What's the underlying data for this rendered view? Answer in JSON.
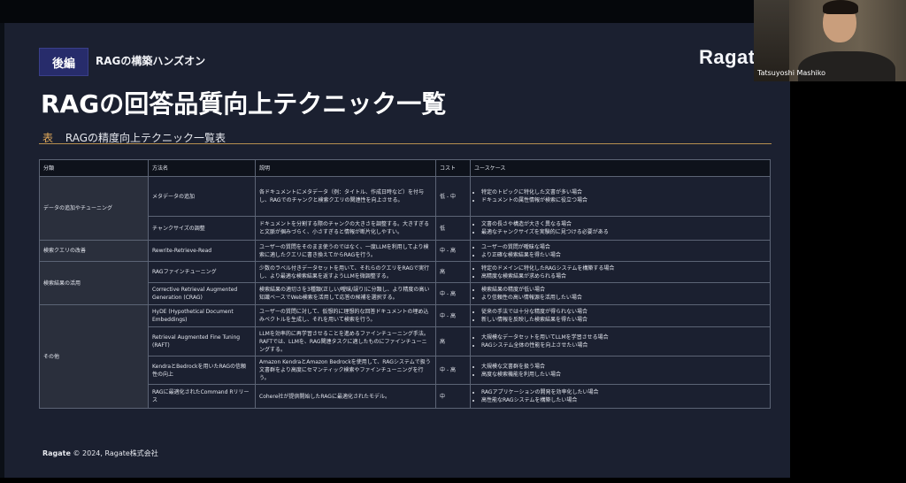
{
  "header": {
    "tag": "後編",
    "subtitle": "RAGの構築ハンズオン",
    "brand": "Ragate"
  },
  "title": "RAGの回答品質向上テクニック一覧",
  "table_caption": {
    "label": "表",
    "text": "RAGの精度向上テクニック一覧表"
  },
  "table": {
    "headers": [
      "分類",
      "方法名",
      "説明",
      "コスト",
      "ユースケース"
    ],
    "rows": [
      {
        "category": "データの追加やチューニング",
        "method": "メタデータの追加",
        "description": "各ドキュメントにメタデータ（例：タイトル、作成日時など）を付与し、RAGでのチャンクと検索クエリの関連性を向上させる。",
        "cost": "低 - 中",
        "usecases": [
          "特定のトピックに特化した文書が多い場合",
          "ドキュメントの属性情報が検索に役立つ場合"
        ]
      },
      {
        "category": "",
        "method": "チャンクサイズの調整",
        "description": "ドキュメントを分割する際のチャンクの大きさを調整する。大きすぎると文脈が掴みづらく、小さすぎると情報が断片化しやすい。",
        "cost": "低",
        "usecases": [
          "文書の長さや構造が大きく異なる場合",
          "最適なチャンクサイズを実験的に見つける必要がある"
        ]
      },
      {
        "category": "検索クエリの改善",
        "method": "Rewrite-Retrieve-Read",
        "description": "ユーザーの質問をそのまま使うのではなく、一度LLMを利用してより検索に適したクエリに書き換えてからRAGを行う。",
        "cost": "中 - 高",
        "usecases": [
          "ユーザーの質問が曖昧な場合",
          "より正確な検索結果を得たい場合"
        ]
      },
      {
        "category": "検索結果の活用",
        "method": "RAGファインチューニング",
        "description": "少数のラベル付きデータセットを用いて、それらのクエリをRAGで実行し、より最適な検索結果を返すようLLMを微調整する。",
        "cost": "高",
        "usecases": [
          "特定のドメインに特化したRAGシステムを構築する場合",
          "高精度な検索結果が求められる場合"
        ]
      },
      {
        "category": "",
        "method": "Corrective Retrieval Augmented Generation (CRAG)",
        "description": "検索結果の適切さを3種類(正しい/曖昧/誤り)に分類し、より精度の高い知識ベースでWeb検索を活用して応答の候補を選択する。",
        "cost": "中 - 高",
        "usecases": [
          "検索結果の精度が低い場合",
          "より信頼性の高い情報源を活用したい場合"
        ]
      },
      {
        "category": "その他",
        "method": "HyDE (Hypothetical Document Embeddings)",
        "description": "ユーザーの質問に対して、仮想的に理想的な回答ドキュメントの埋め込みベクトルを生成し、それを用いて検索を行う。",
        "cost": "中 - 高",
        "usecases": [
          "従来の手法では十分な精度が得られない場合",
          "新しい情報を反映した検索結果を得たい場合"
        ]
      },
      {
        "category": "",
        "method": "Retrieval Augmented Fine Tuning (RAFT)",
        "description": "LLMを効率的に再学習させることを進めるファインチューニング手法。RAFTでは、LLMを、RAG関連タスクに適したものにファインチューニングする。",
        "cost": "高",
        "usecases": [
          "大規模なデータセットを用いてLLMを学習させる場合",
          "RAGシステム全体の性能を向上させたい場合"
        ]
      },
      {
        "category": "",
        "method": "KendraとBedrockを用いたRAGの信頼性の向上",
        "description": "Amazon KendraとAmazon Bedrockを使用して、RAGシステムで扱う文書群をより高度にセマンティック検索やファインチューニングを行う。",
        "cost": "中 - 高",
        "usecases": [
          "大規模な文書群を扱う場合",
          "高度な検索機能を利用したい場合"
        ]
      },
      {
        "category": "",
        "method": "RAGに最適化されたCommand Rリリース",
        "description": "Cohere社が提供開始したRAGに最適化されたモデル。",
        "cost": "中",
        "usecases": [
          "RAGアプリケーションの開発を効率化したい場合",
          "高性能なRAGシステムを構築したい場合"
        ]
      }
    ]
  },
  "footer": {
    "brand": "Ragate",
    "copyright": "© 2024, Ragate株式会社"
  },
  "webcam": {
    "name": "Tatsuyoshi Mashiko"
  }
}
